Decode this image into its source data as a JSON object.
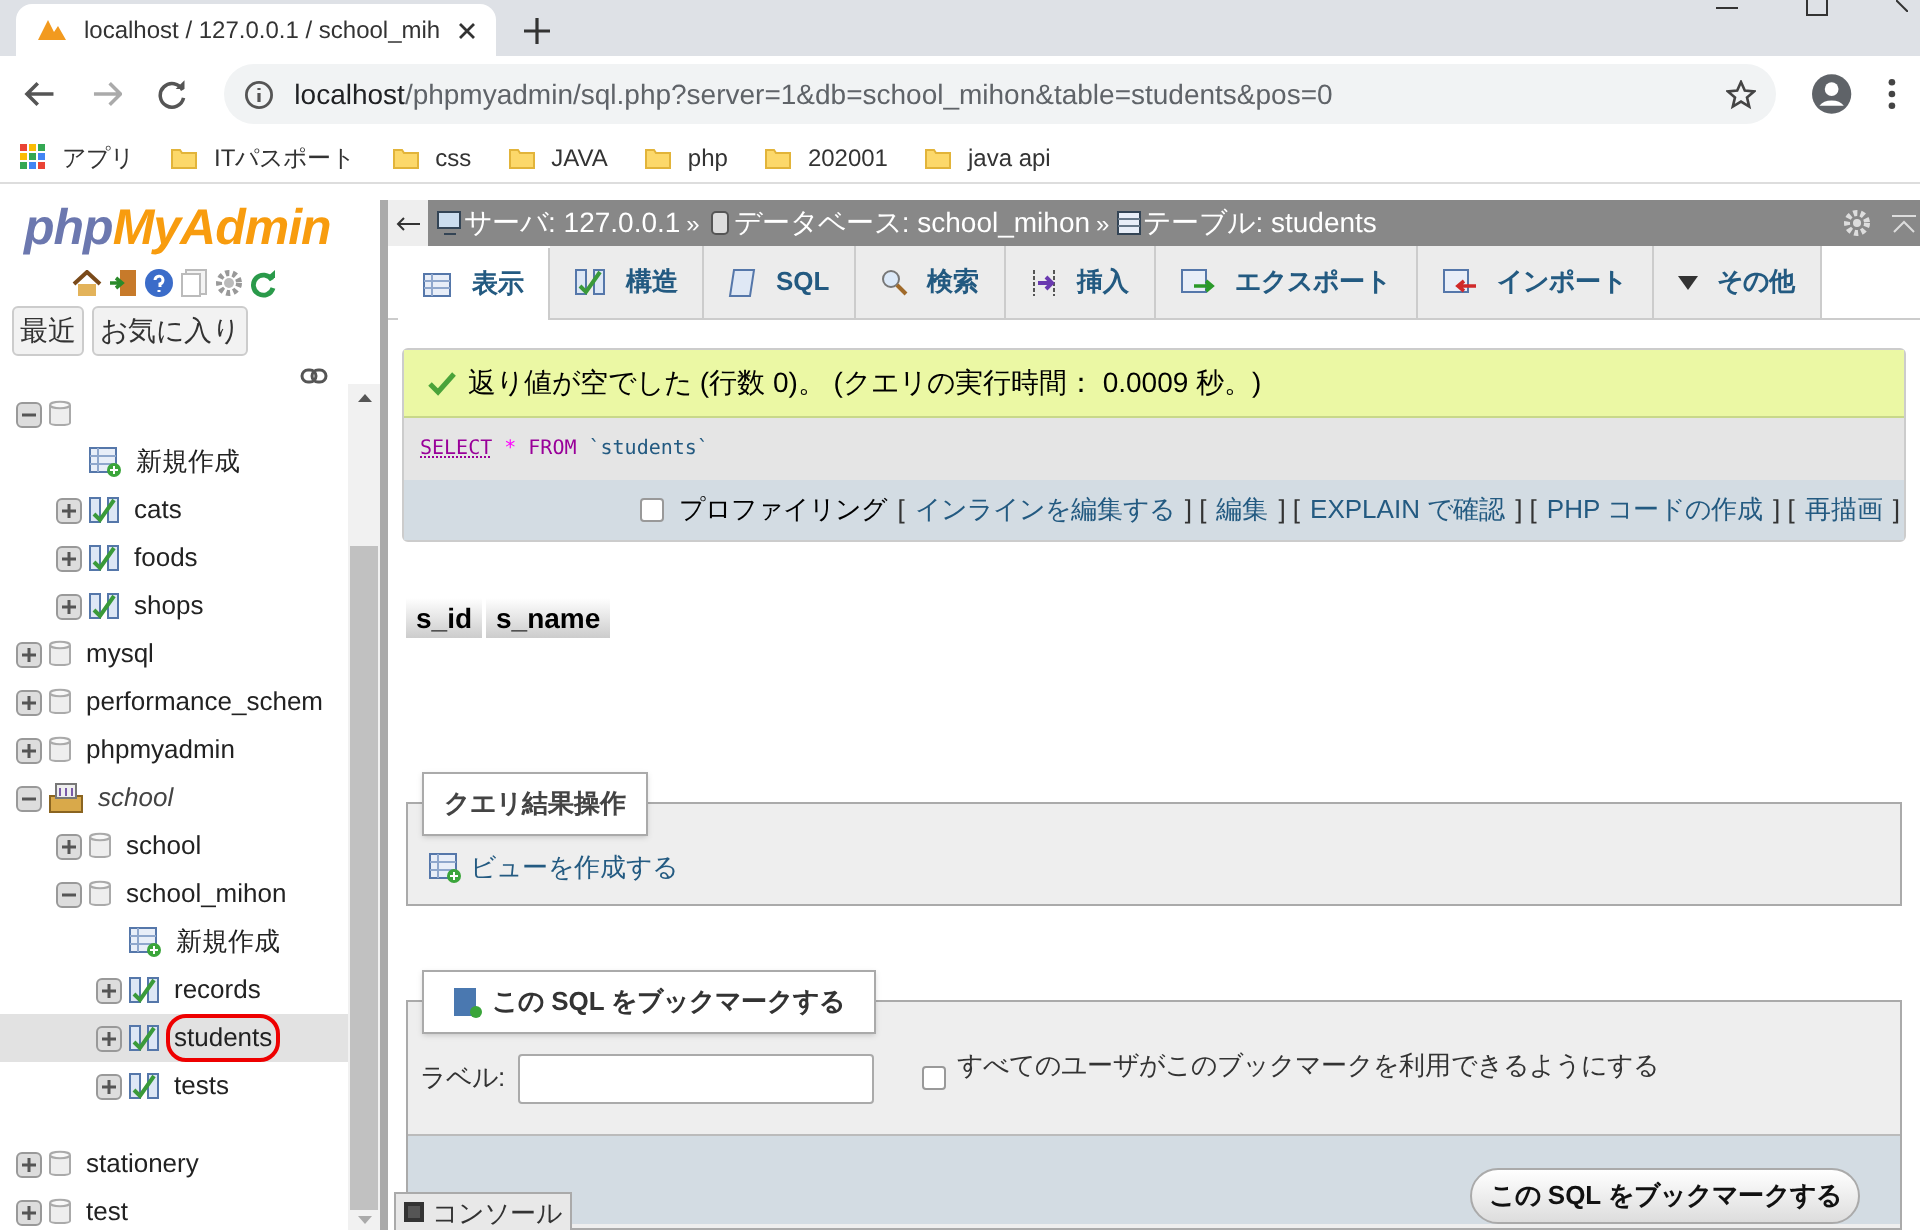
{
  "browser": {
    "tab_title": "localhost / 127.0.0.1 / school_mih",
    "url_host": "localhost",
    "url_path": "/phpmyadmin/sql.php?server=1&db=school_mihon&table=students&pos=0",
    "bookmarks": [
      {
        "kind": "apps",
        "label": "アプリ"
      },
      {
        "kind": "folder",
        "label": "ITパスポート"
      },
      {
        "kind": "folder",
        "label": "css"
      },
      {
        "kind": "folder",
        "label": "JAVA"
      },
      {
        "kind": "folder",
        "label": "php"
      },
      {
        "kind": "folder",
        "label": "202001"
      },
      {
        "kind": "folder",
        "label": "java api"
      }
    ]
  },
  "sidebar": {
    "logo": {
      "part_1": "php",
      "part_2": "MyAdmin"
    },
    "buttons": [
      "最近",
      "お気に入り"
    ],
    "tree": [
      {
        "kind": "db",
        "expanded": true,
        "children": [
          {
            "kind": "new",
            "label": "新規作成"
          },
          {
            "kind": "table",
            "label": "cats",
            "selected": false,
            "circled": false
          },
          {
            "kind": "table",
            "label": "foods",
            "selected": false,
            "circled": false
          },
          {
            "kind": "table",
            "label": "shops",
            "selected": false,
            "circled": false
          }
        ]
      },
      {
        "kind": "db",
        "label": "mysql",
        "expanded": false
      },
      {
        "kind": "db",
        "label": "performance_schem",
        "expanded": false
      },
      {
        "kind": "db",
        "label": "phpmyadmin",
        "expanded": false
      },
      {
        "kind": "group",
        "label": "school",
        "expanded": true,
        "children": [
          {
            "kind": "db",
            "label": "school",
            "expanded": false
          },
          {
            "kind": "db",
            "label": "school_mihon",
            "expanded": true,
            "children": [
              {
                "kind": "new",
                "label": "新規作成"
              },
              {
                "kind": "table",
                "label": "records",
                "selected": false,
                "circled": false
              },
              {
                "kind": "table",
                "label": "students",
                "selected": true,
                "circled": true
              },
              {
                "kind": "table",
                "label": "tests",
                "selected": false,
                "circled": false
              }
            ]
          }
        ]
      },
      {
        "kind": "db",
        "label": "stationery",
        "expanded": false
      },
      {
        "kind": "db",
        "label": "test",
        "expanded": false
      }
    ]
  },
  "breadcrumb": [
    {
      "kind": "server",
      "label": "サーバ: 127.0.0.1"
    },
    {
      "kind": "database",
      "separator": "»",
      "label": "データベース: school_mihon"
    },
    {
      "kind": "table",
      "separator": "»",
      "label": "テーブル: students"
    }
  ],
  "tabs": [
    {
      "kind": "browse",
      "label": "表示",
      "selected": true
    },
    {
      "kind": "structure",
      "label": "構造",
      "selected": false
    },
    {
      "kind": "sql",
      "label": "SQL",
      "selected": false
    },
    {
      "kind": "search",
      "label": "検索",
      "selected": false
    },
    {
      "kind": "insert",
      "label": "挿入",
      "selected": false
    },
    {
      "kind": "export",
      "label": "エクスポート",
      "selected": false
    },
    {
      "kind": "import",
      "label": "インポート",
      "selected": false
    },
    {
      "kind": "more",
      "label": "その他",
      "selected": false
    }
  ],
  "message": "返り値が空でした (行数 0)。 (クエリの実行時間： 0.0009 秒。)",
  "sql": [
    {
      "kind": "keyword",
      "text": "SELECT"
    },
    {
      "kind": "operator",
      "text": "*"
    },
    {
      "kind": "keyword",
      "text": "FROM"
    },
    {
      "kind": "identifier",
      "text": "`students`"
    }
  ],
  "profiling": {
    "checked": false,
    "label": "プロファイリング",
    "open": "[",
    "separator": "] [",
    "close": "]",
    "links": [
      "インラインを編集する",
      "編集",
      "EXPLAIN で確認",
      "PHP コードの作成",
      "再描画"
    ]
  },
  "table": {
    "columns": [
      "s_id",
      "s_name"
    ]
  },
  "query_ops": {
    "title": "クエリ結果操作",
    "link": "ビューを作成する"
  },
  "bookmark": {
    "title": "この SQL をブックマークする",
    "label": "ラベル:",
    "share_checked": false,
    "share_label": "すべてのユーザがこのブックマークを利用できるようにする",
    "button": "この SQL をブックマークする"
  },
  "console": "コンソール"
}
